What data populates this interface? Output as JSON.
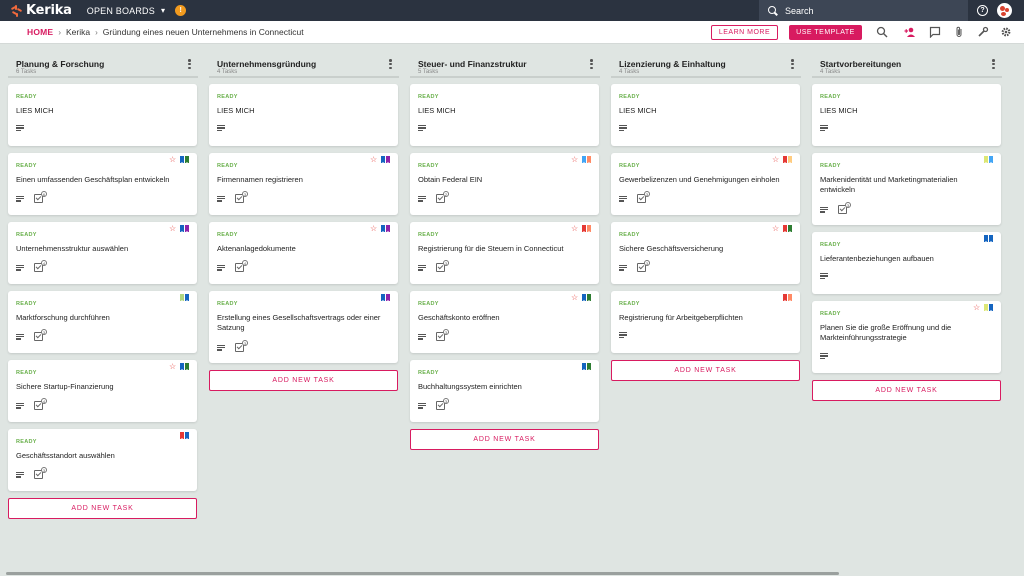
{
  "app": {
    "logo": "Kerika",
    "open_boards": "OPEN BOARDS",
    "badge": "!"
  },
  "search": {
    "placeholder": "Search"
  },
  "help": "?",
  "breadcrumb": {
    "home": "HOME",
    "account": "Kerika",
    "board": "Gründung eines neuen Unternehmens in Connecticut"
  },
  "buttons": {
    "learn_more": "LEARN MORE",
    "use_template": "USE TEMPLATE"
  },
  "add_task_label": "ADD NEW TASK",
  "colors": {
    "accent": "#d81b60",
    "topbar": "#2b3340",
    "ready": "#6ab04c",
    "background": "#dfe5e2"
  },
  "columns": [
    {
      "title": "Planung & Forschung",
      "count": "6 Tasks",
      "cards": [
        {
          "status": "READY",
          "title": "LIES MICH",
          "checklist": false,
          "star": false,
          "flags": []
        },
        {
          "status": "READY",
          "title": "Einen umfassenden Geschäftsplan entwickeln",
          "checklist": true,
          "checklist_count": "6",
          "star": true,
          "flags": [
            "#1565c0",
            "#2e7d32"
          ]
        },
        {
          "status": "READY",
          "title": "Unternehmensstruktur auswählen",
          "checklist": true,
          "checklist_count": "4",
          "star": true,
          "flags": [
            "#1565c0",
            "#8e24aa"
          ]
        },
        {
          "status": "READY",
          "title": "Marktforschung durchführen",
          "checklist": true,
          "checklist_count": "3",
          "star": false,
          "flags": [
            "#aed581",
            "#1565c0"
          ]
        },
        {
          "status": "READY",
          "title": "Sichere Startup-Finanzierung",
          "checklist": true,
          "checklist_count": "4",
          "star": true,
          "flags": [
            "#1565c0",
            "#2e7d32"
          ]
        },
        {
          "status": "READY",
          "title": "Geschäftsstandort auswählen",
          "checklist": true,
          "checklist_count": "3",
          "star": false,
          "flags": [
            "#e53935",
            "#1565c0"
          ]
        }
      ]
    },
    {
      "title": "Unternehmensgründung",
      "count": "4 Tasks",
      "cards": [
        {
          "status": "READY",
          "title": "LIES MICH",
          "checklist": false,
          "star": false,
          "flags": []
        },
        {
          "status": "READY",
          "title": "Firmennamen registrieren",
          "checklist": true,
          "checklist_count": "3",
          "star": true,
          "flags": [
            "#1565c0",
            "#8e24aa"
          ]
        },
        {
          "status": "READY",
          "title": "Aktenanlagedokumente",
          "checklist": true,
          "checklist_count": "4",
          "star": true,
          "flags": [
            "#1565c0",
            "#8e24aa"
          ]
        },
        {
          "status": "READY",
          "title": "Erstellung eines Gesellschaftsvertrags oder einer Satzung",
          "checklist": true,
          "checklist_count": "3",
          "star": false,
          "flags": [
            "#1565c0",
            "#8e24aa"
          ]
        }
      ]
    },
    {
      "title": "Steuer- und Finanzstruktur",
      "count": "5 Tasks",
      "cards": [
        {
          "status": "READY",
          "title": "LIES MICH",
          "checklist": false,
          "star": false,
          "flags": []
        },
        {
          "status": "READY",
          "title": "Obtain Federal EIN",
          "checklist": true,
          "checklist_count": "2",
          "star": true,
          "flags": [
            "#42a5f5",
            "#ff8a65"
          ]
        },
        {
          "status": "READY",
          "title": "Registrierung für die Steuern in Connecticut",
          "checklist": true,
          "checklist_count": "3",
          "star": true,
          "flags": [
            "#e53935",
            "#ff8a65"
          ]
        },
        {
          "status": "READY",
          "title": "Geschäftskonto eröffnen",
          "checklist": true,
          "checklist_count": "3",
          "star": true,
          "flags": [
            "#1565c0",
            "#2e7d32"
          ]
        },
        {
          "status": "READY",
          "title": "Buchhaltungssystem einrichten",
          "checklist": true,
          "checklist_count": "3",
          "star": false,
          "flags": [
            "#1565c0",
            "#2e7d32"
          ]
        }
      ]
    },
    {
      "title": "Lizenzierung & Einhaltung",
      "count": "4 Tasks",
      "cards": [
        {
          "status": "READY",
          "title": "LIES MICH",
          "checklist": false,
          "star": false,
          "flags": []
        },
        {
          "status": "READY",
          "title": "Gewerbelizenzen und Genehmigungen einholen",
          "checklist": true,
          "checklist_count": "3",
          "star": true,
          "flags": [
            "#e53935",
            "#ffcc80"
          ]
        },
        {
          "status": "READY",
          "title": "Sichere Geschäftsversicherung",
          "checklist": true,
          "checklist_count": "3",
          "star": true,
          "flags": [
            "#e53935",
            "#2e7d32"
          ]
        },
        {
          "status": "READY",
          "title": "Registrierung für Arbeitgeberpflichten",
          "checklist": false,
          "star": false,
          "flags": [
            "#e53935",
            "#ff8a65"
          ]
        }
      ]
    },
    {
      "title": "Startvorbereitungen",
      "count": "4 Tasks",
      "cards": [
        {
          "status": "READY",
          "title": "LIES MICH",
          "checklist": false,
          "star": false,
          "flags": []
        },
        {
          "status": "READY",
          "title": "Markenidentität und Marketingmaterialien entwickeln",
          "checklist": true,
          "checklist_count": "3",
          "star": false,
          "flags": [
            "#dce775",
            "#42a5f5"
          ]
        },
        {
          "status": "READY",
          "title": "Lieferantenbeziehungen aufbauen",
          "checklist": false,
          "star": false,
          "flags": [
            "#1565c0",
            "#1565c0"
          ]
        },
        {
          "status": "READY",
          "title": "Planen Sie die große Eröffnung und die Markteinführungsstrategie",
          "checklist": false,
          "star": true,
          "flags": [
            "#dce775",
            "#1565c0"
          ]
        }
      ]
    }
  ]
}
